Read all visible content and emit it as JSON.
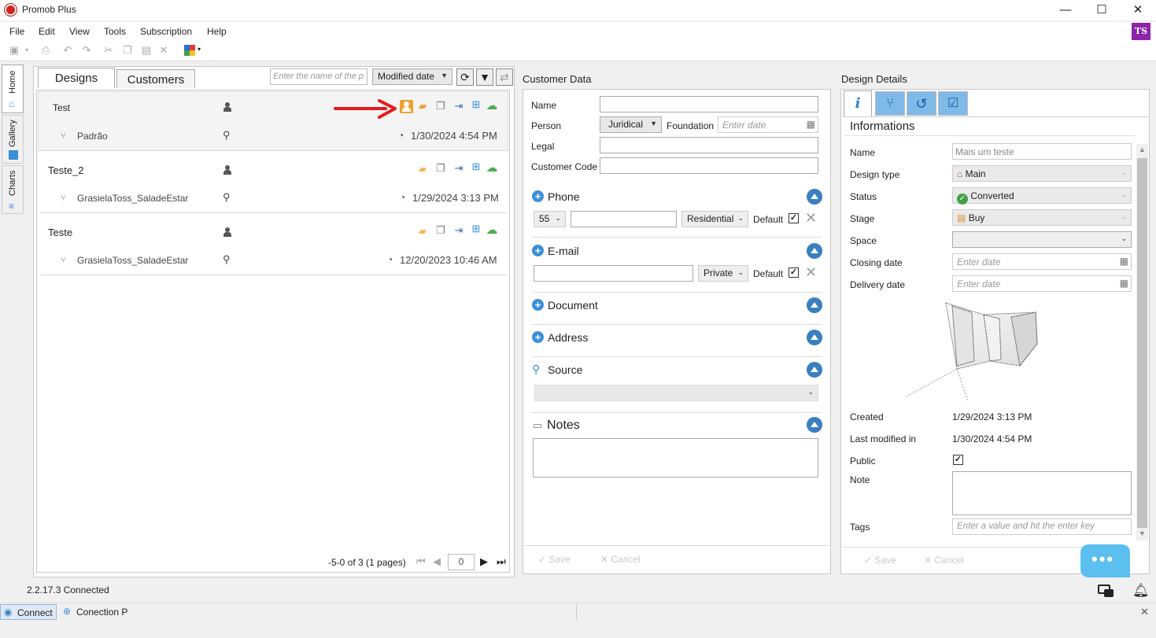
{
  "window": {
    "title": "Promob Plus",
    "minimize": "—",
    "maximize": "☐",
    "close": "✕"
  },
  "menu": [
    "File",
    "Edit",
    "View",
    "Tools",
    "Subscription",
    "Help"
  ],
  "user_initials": "TS",
  "side_tabs": [
    "Home",
    "Gallery",
    "Charts"
  ],
  "designs_panel": {
    "tabs": [
      "Designs",
      "Customers"
    ],
    "search_placeholder": "Enter the name of the p",
    "sort": "Modified date",
    "items": [
      {
        "name": "Test",
        "sub": "Padrão",
        "date": "1/30/2024 4:54 PM"
      },
      {
        "name": "Teste_2",
        "sub": "GrasielaToss_SaladeEstar",
        "date": "1/29/2024 3:13 PM"
      },
      {
        "name": "Teste",
        "sub": "GrasielaToss_SaladeEstar",
        "date": "12/20/2023 10:46 AM"
      }
    ],
    "pagination": {
      "text": "-5-0 of 3 (1 pages)",
      "page": "0"
    }
  },
  "customer": {
    "title": "Customer Data",
    "name_label": "Name",
    "person_label": "Person",
    "person_value": "Juridical",
    "foundation_label": "Foundation",
    "foundation_placeholder": "Enter date",
    "legal_label": "Legal",
    "code_label": "Customer Code",
    "phone": {
      "label": "Phone",
      "ddi": "55",
      "type": "Residential",
      "default_label": "Default"
    },
    "email": {
      "label": "E-mail",
      "type": "Private",
      "default_label": "Default"
    },
    "document_label": "Document",
    "address_label": "Address",
    "source_label": "Source",
    "notes_label": "Notes",
    "save": "Save",
    "cancel": "Cancel"
  },
  "design_details": {
    "title": "Design Details",
    "section": "Informations",
    "name_label": "Name",
    "name_value": "Mais um teste",
    "type_label": "Design type",
    "type_value": "Main",
    "status_label": "Status",
    "status_value": "Converted",
    "stage_label": "Stage",
    "stage_value": "Buy",
    "space_label": "Space",
    "closing_label": "Closing date",
    "delivery_label": "Delivery date",
    "date_placeholder": "Enter date",
    "created_label": "Created",
    "created_value": "1/29/2024 3:13 PM",
    "modified_label": "Last modified in",
    "modified_value": "1/30/2024 4:54 PM",
    "public_label": "Public",
    "note_label": "Note",
    "tags_label": "Tags",
    "tags_placeholder": "Enter a value and hit the enter key",
    "save": "Save",
    "cancel": "Cancel"
  },
  "status": {
    "version": "2.2.17.3",
    "state": "Connected"
  },
  "bottom": {
    "connect": "Connect",
    "conection": "Conection P"
  },
  "colors": {
    "accent": "#3a8fd9",
    "arrow": "#e8191c",
    "cloud": "#4caf50",
    "folder": "#f0a030",
    "chat": "#5bc0f0"
  }
}
